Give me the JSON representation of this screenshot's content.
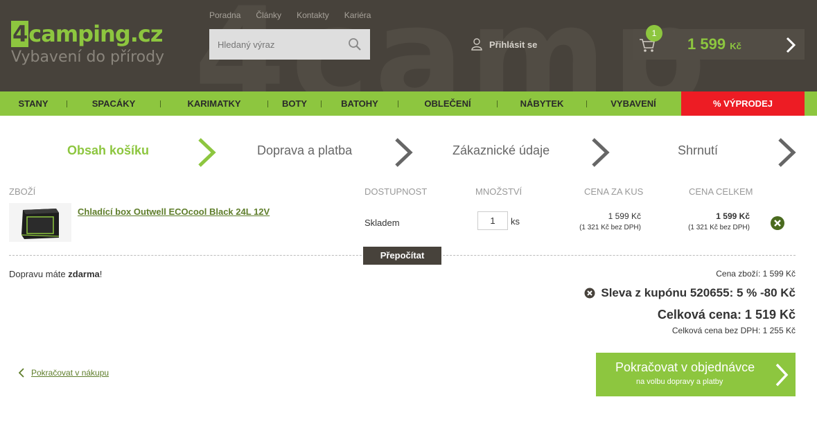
{
  "header": {
    "logo_main_prefix": "4",
    "logo_main_rest": "camping.cz",
    "logo_sub": "Vybavení do přírody",
    "top_links": [
      "Poradna",
      "Články",
      "Kontakty",
      "Kariéra"
    ],
    "search_placeholder": "Hledaný výraz",
    "login_label": "Přihlásit se",
    "cart_count": "1",
    "cart_total": "1 599",
    "cart_currency": "Kč"
  },
  "nav": {
    "items": [
      "STANY",
      "SPACÁKY",
      "KARIMATKY",
      "BOTY",
      "BATOHY",
      "OBLEČENÍ",
      "NÁBYTEK",
      "VYBAVENÍ"
    ],
    "sale": "% VÝPRODEJ"
  },
  "steps": [
    "Obsah košíku",
    "Doprava a platba",
    "Zákaznické údaje",
    "Shrnutí"
  ],
  "table": {
    "headers": [
      "ZBOŽÍ",
      "DOSTUPNOST",
      "MNOŽSTVÍ",
      "CENA ZA KUS",
      "CENA CELKEM"
    ],
    "row": {
      "name": "Chladící box Outwell ECOcool Black 24L 12V",
      "availability": "Skladem",
      "quantity": "1",
      "unit": "ks",
      "unit_price": "1 599 Kč",
      "unit_price_net": "(1 321 Kč bez DPH)",
      "total_price": "1 599 Kč",
      "total_price_net": "(1 321 Kč bez DPH)"
    },
    "recalc_label": "Přepočítat"
  },
  "shipping": {
    "prefix": "Dopravu máte ",
    "bold": "zdarma",
    "suffix": "!"
  },
  "summary": {
    "goods_price": "Cena zboží: 1 599 Kč",
    "coupon": "Sleva z kupónu 520655: 5 % -80 Kč",
    "total": "Celková cena: 1 519 Kč",
    "total_net": "Celková cena bez DPH: 1 255 Kč"
  },
  "actions": {
    "back_label": "Pokračovat v nákupu",
    "continue_main": "Pokračovat v objednávce",
    "continue_sub": "na volbu dopravy a platby"
  },
  "colors": {
    "brand_green": "#8dc63f",
    "header_bg": "#47423b",
    "sale_red": "#ed1c24"
  }
}
